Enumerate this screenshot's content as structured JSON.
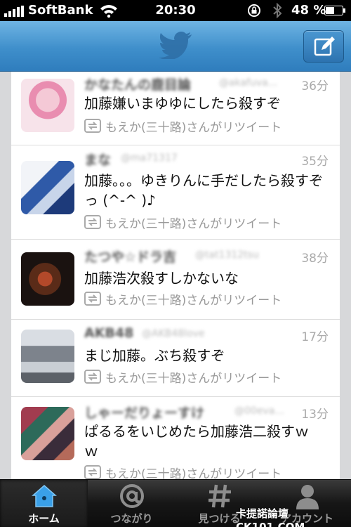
{
  "status_bar": {
    "carrier": "SoftBank",
    "time": "20:30",
    "battery": "48 %"
  },
  "nav": {
    "logo_icon": "twitter-bird-icon",
    "compose_icon": "compose-icon",
    "accent": "#3f8fcb"
  },
  "tweets": [
    {
      "name": "かなたんの鹿目論",
      "handle": "@akafuva...",
      "time": "36分",
      "text": "加藤嫌いまゆゆにしたら殺すぞ",
      "retweet": "もえか(三十路)さんがリツイート"
    },
    {
      "name": "まな",
      "handle": "@ma71317",
      "time": "35分",
      "text": "加藤。。。ゆきりんに手だしたら殺すぞっ (^-^ )♪",
      "retweet": "もえか(三十路)さんがリツイート"
    },
    {
      "name": "たつや☆ドラ吉",
      "handle": "@tat1312tsu",
      "time": "38分",
      "text": "加藤浩次殺すしかないな",
      "retweet": "もえか(三十路)さんがリツイート"
    },
    {
      "name": "AKB48",
      "handle": "@AKB48love",
      "time": "17分",
      "text": "まじ加藤。ぶち殺すぞ",
      "retweet": "もえか(三十路)さんがリツイート"
    },
    {
      "name": "しゃーだりょーすけ",
      "handle": "@00eva...",
      "time": "13分",
      "text": "ぱるるをいじめたら加藤浩二殺すｗｗ",
      "retweet": "もえか(三十路)さんがリツイート"
    }
  ],
  "tabs": [
    {
      "label": "ホーム",
      "icon": "home-icon"
    },
    {
      "label": "つながり",
      "icon": "at-icon"
    },
    {
      "label": "見つける",
      "icon": "hash-icon"
    },
    {
      "label": "アカウント",
      "icon": "person-icon"
    }
  ],
  "watermark": "卡提諾論壇 CK101.COM"
}
